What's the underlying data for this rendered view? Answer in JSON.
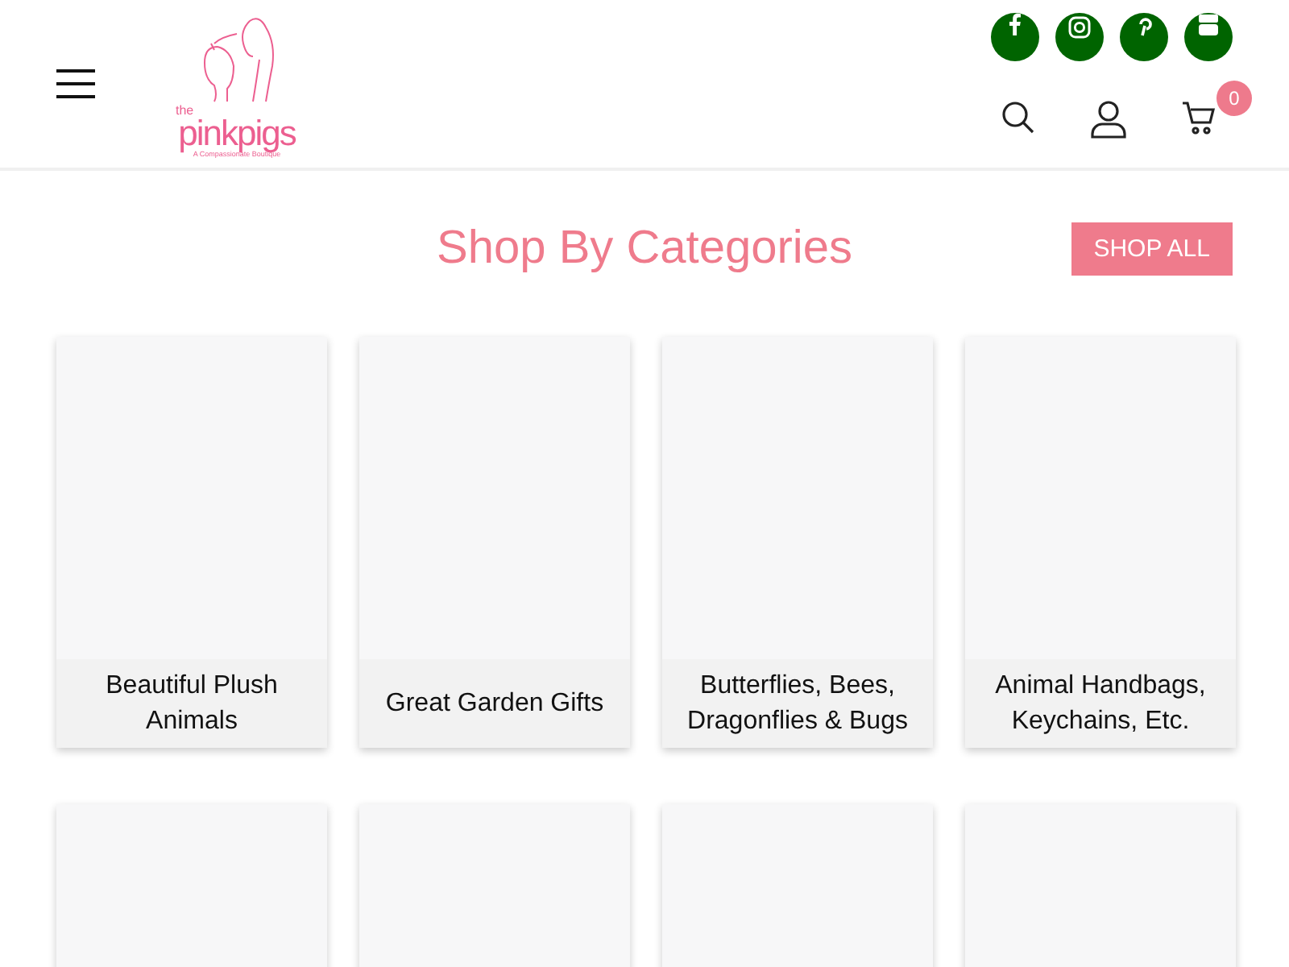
{
  "logo": {
    "small": "the",
    "name": "pinkpigs",
    "tagline": "A Compassionate Boutique"
  },
  "cart": {
    "count": "0"
  },
  "section": {
    "title": "Shop By Categories",
    "button": "SHOP ALL"
  },
  "categories": [
    {
      "label": "Beautiful Plush Animals"
    },
    {
      "label": "Great Garden Gifts"
    },
    {
      "label": "Butterflies, Bees, Dragonflies & Bugs"
    },
    {
      "label": "Animal Handbags, Keychains, Etc."
    }
  ]
}
